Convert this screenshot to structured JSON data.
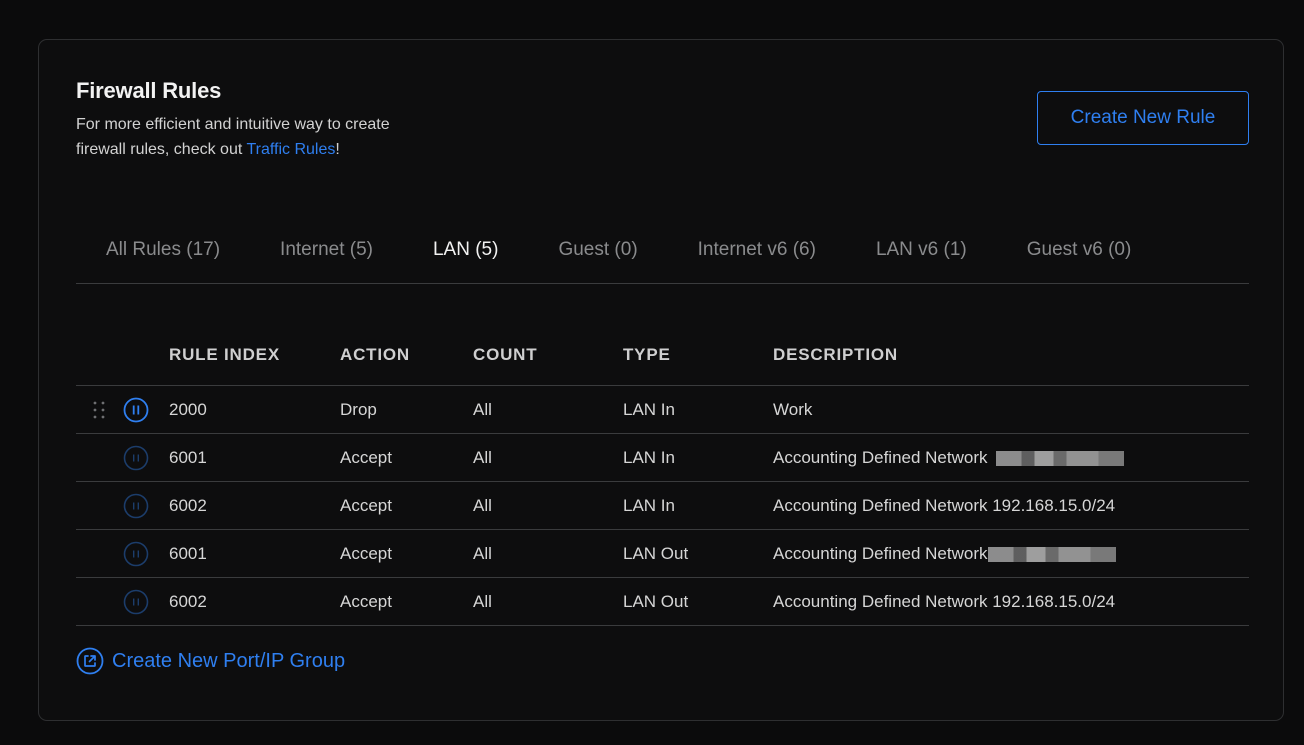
{
  "header": {
    "title": "Firewall Rules",
    "subtitle_line1": "For more efficient and intuitive way to create",
    "subtitle_line2_prefix": "firewall rules, check out ",
    "subtitle_link": "Traffic Rules",
    "subtitle_suffix": "!"
  },
  "create_rule_button": "Create New Rule",
  "tabs": [
    {
      "label": "All Rules (17)",
      "active": false
    },
    {
      "label": "Internet (5)",
      "active": false
    },
    {
      "label": "LAN (5)",
      "active": true
    },
    {
      "label": "Guest (0)",
      "active": false
    },
    {
      "label": "Internet v6 (6)",
      "active": false
    },
    {
      "label": "LAN v6 (1)",
      "active": false
    },
    {
      "label": "Guest v6 (0)",
      "active": false
    }
  ],
  "table": {
    "columns": [
      "RULE INDEX",
      "ACTION",
      "COUNT",
      "TYPE",
      "DESCRIPTION"
    ],
    "rows": [
      {
        "index": "2000",
        "action": "Drop",
        "count": "All",
        "type": "LAN In",
        "description": "Work",
        "active": true
      },
      {
        "index": "6001",
        "action": "Accept",
        "count": "All",
        "type": "LAN In",
        "description": "Accounting Defined Network",
        "active": false
      },
      {
        "index": "6002",
        "action": "Accept",
        "count": "All",
        "type": "LAN In",
        "description": "Accounting Defined Network 192.168.15.0/24",
        "active": false
      },
      {
        "index": "6001",
        "action": "Accept",
        "count": "All",
        "type": "LAN Out",
        "description": "Accounting Defined Network",
        "active": false
      },
      {
        "index": "6002",
        "action": "Accept",
        "count": "All",
        "type": "LAN Out",
        "description": "Accounting Defined Network 192.168.15.0/24",
        "active": false
      }
    ]
  },
  "footer_link": "Create New Port/IP Group",
  "colors": {
    "accent": "#2f7ff0",
    "background": "#0b0b0c",
    "border": "#3a3b3d"
  }
}
